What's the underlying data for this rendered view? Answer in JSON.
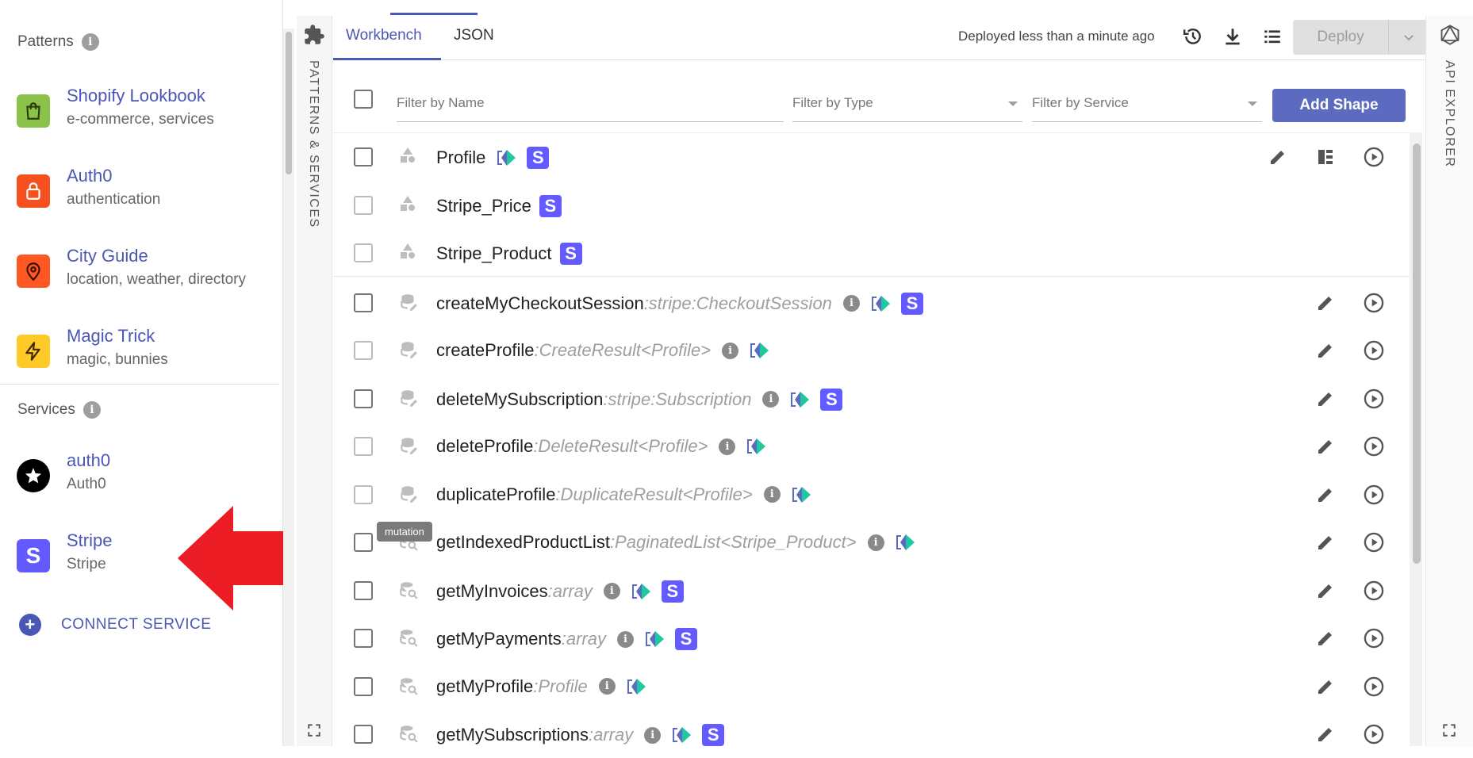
{
  "sidebar": {
    "patterns_heading": "Patterns",
    "services_heading": "Services",
    "patterns": [
      {
        "title": "Shopify Lookbook",
        "subtitle": "e-commerce, services",
        "color": "#8bc34a",
        "icon": "shopping-bag-icon"
      },
      {
        "title": "Auth0",
        "subtitle": "authentication",
        "color": "#f4511e",
        "icon": "lock-icon"
      },
      {
        "title": "City Guide",
        "subtitle": "location, weather, directory",
        "color": "#ff5722",
        "icon": "location-pin-icon"
      },
      {
        "title": "Magic Trick",
        "subtitle": "magic, bunnies",
        "color": "#ffca28",
        "icon": "lightning-icon"
      }
    ],
    "services": [
      {
        "title": "auth0",
        "subtitle": "Auth0",
        "icon": "auth0-logo-icon"
      },
      {
        "title": "Stripe",
        "subtitle": "Stripe",
        "icon": "stripe-logo-icon"
      }
    ],
    "connect_label": "CONNECT SERVICE"
  },
  "strips": {
    "left_label": "PATTERNS & SERVICES",
    "right_label": "API EXPLORER"
  },
  "header": {
    "tabs": [
      "Workbench",
      "JSON"
    ],
    "active_tab": "Workbench",
    "deploy_status": "Deployed less than a minute ago",
    "deploy_label": "Deploy"
  },
  "filters": {
    "name_placeholder": "Filter by Name",
    "type_placeholder": "Filter by Type",
    "service_placeholder": "Filter by Service",
    "add_shape_label": "Add Shape"
  },
  "tooltip": "mutation",
  "rows": [
    {
      "name": "Profile",
      "ret": "",
      "kind": "shape",
      "info": false,
      "graphql": true,
      "stripe": true
    },
    {
      "name": "Stripe_Price",
      "ret": "",
      "kind": "shape",
      "info": false,
      "graphql": false,
      "stripe": true
    },
    {
      "name": "Stripe_Product",
      "ret": "",
      "kind": "shape",
      "info": false,
      "graphql": false,
      "stripe": true
    },
    {
      "name": "createMyCheckoutSession",
      "ret": ":stripe:CheckoutSession",
      "kind": "mutation",
      "info": true,
      "graphql": true,
      "stripe": true
    },
    {
      "name": "createProfile",
      "ret": ":CreateResult<Profile>",
      "kind": "mutation",
      "info": true,
      "graphql": true,
      "stripe": false
    },
    {
      "name": "deleteMySubscription",
      "ret": ":stripe:Subscription",
      "kind": "mutation",
      "info": true,
      "graphql": true,
      "stripe": true
    },
    {
      "name": "deleteProfile",
      "ret": ":DeleteResult<Profile>",
      "kind": "mutation",
      "info": true,
      "graphql": true,
      "stripe": false
    },
    {
      "name": "duplicateProfile",
      "ret": ":DuplicateResult<Profile>",
      "kind": "mutation",
      "info": true,
      "graphql": true,
      "stripe": false
    },
    {
      "name": "getIndexedProductList",
      "ret": ":PaginatedList<Stripe_Product>",
      "kind": "query",
      "info": true,
      "graphql": true,
      "stripe": false
    },
    {
      "name": "getMyInvoices",
      "ret": ":array",
      "kind": "query",
      "info": true,
      "graphql": true,
      "stripe": true
    },
    {
      "name": "getMyPayments",
      "ret": ":array",
      "kind": "query",
      "info": true,
      "graphql": true,
      "stripe": true
    },
    {
      "name": "getMyProfile",
      "ret": ":Profile",
      "kind": "query",
      "info": true,
      "graphql": true,
      "stripe": false
    },
    {
      "name": "getMySubscriptions",
      "ret": ":array",
      "kind": "query",
      "info": true,
      "graphql": true,
      "stripe": true
    }
  ]
}
